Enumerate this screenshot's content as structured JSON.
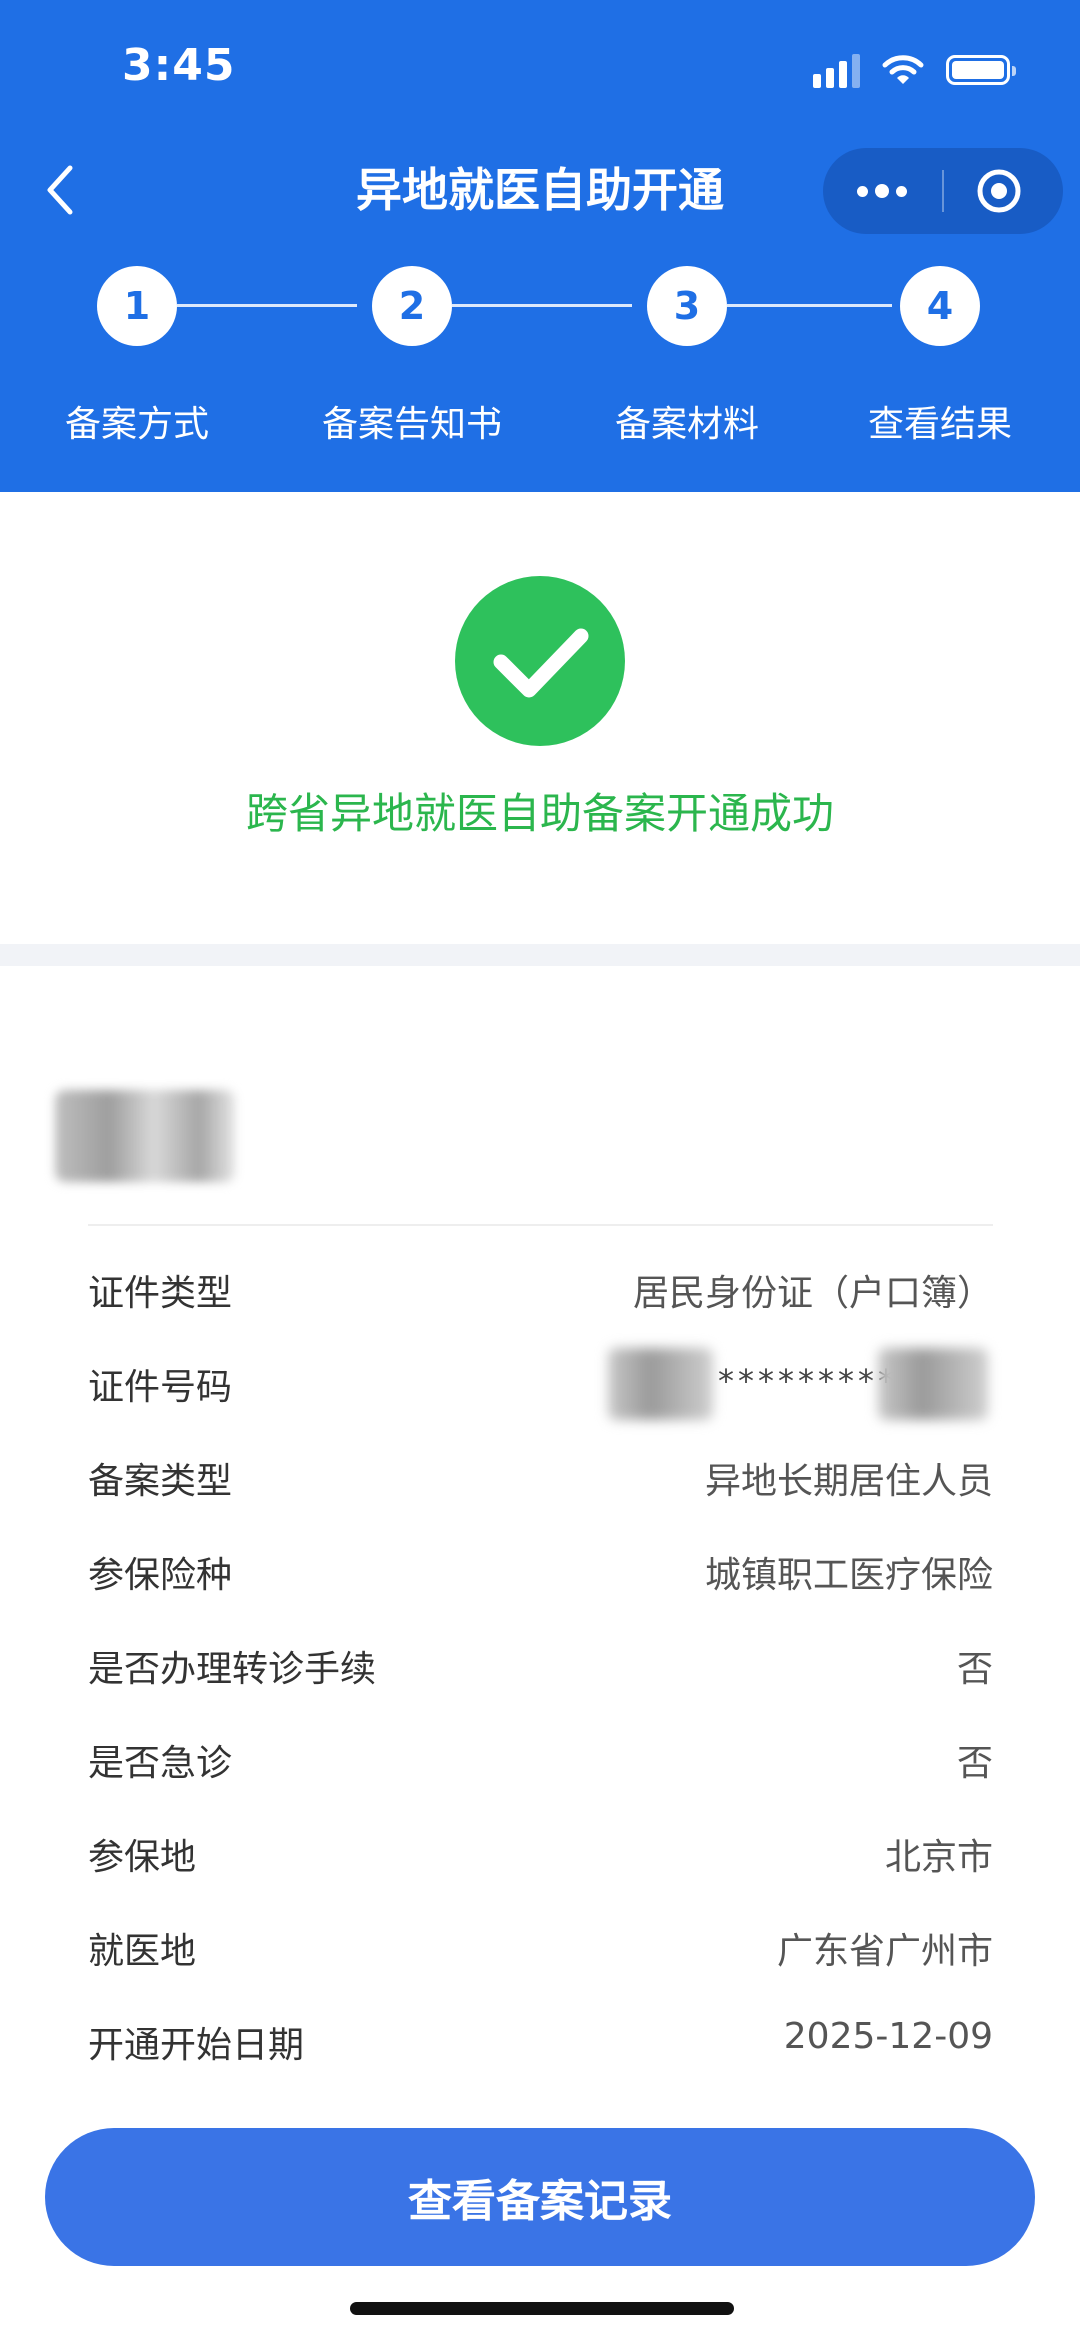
{
  "status_bar": {
    "time": "3:45"
  },
  "nav": {
    "title": "异地就医自助开通"
  },
  "steps": [
    {
      "number": "1",
      "label": "备案方式"
    },
    {
      "number": "2",
      "label": "备案告知书"
    },
    {
      "number": "3",
      "label": "备案材料"
    },
    {
      "number": "4",
      "label": "查看结果"
    }
  ],
  "result": {
    "message": "跨省异地就医自助备案开通成功",
    "color": "#2bb64d"
  },
  "details": [
    {
      "label": "证件类型",
      "value": "居民身份证（户口簿）"
    },
    {
      "label": "证件号码",
      "value": "*********"
    },
    {
      "label": "备案类型",
      "value": "异地长期居住人员"
    },
    {
      "label": "参保险种",
      "value": "城镇职工医疗保险"
    },
    {
      "label": "是否办理转诊手续",
      "value": "否"
    },
    {
      "label": "是否急诊",
      "value": "否"
    },
    {
      "label": "参保地",
      "value": "北京市"
    },
    {
      "label": "就医地",
      "value": "广东省广州市"
    },
    {
      "label": "开通开始日期",
      "value": "2025-12-09"
    }
  ],
  "actions": {
    "view_records": "查看备案记录"
  },
  "colors": {
    "header": "#1f6fe5",
    "button": "#3a74e6",
    "success": "#2ec15c"
  }
}
